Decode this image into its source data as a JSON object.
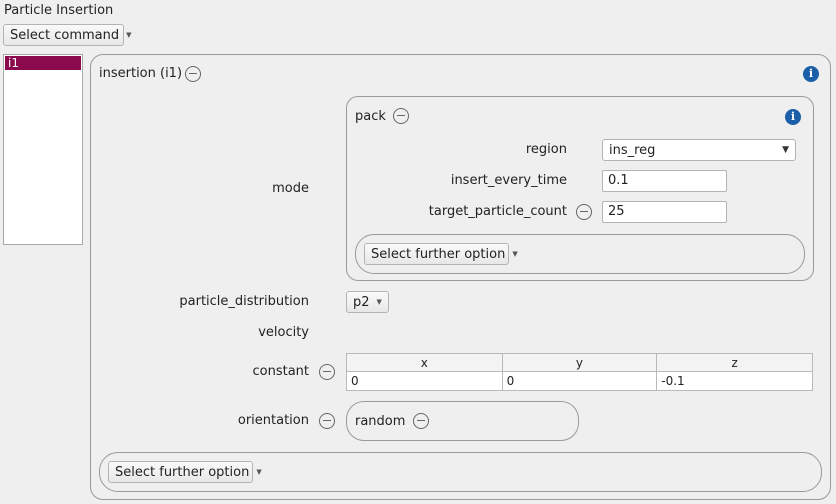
{
  "page": {
    "title": "Particle Insertion"
  },
  "toolbar": {
    "select_command": "Select command"
  },
  "instances": [
    "i1"
  ],
  "insertion": {
    "title": "insertion (i1)",
    "mode_label": "mode",
    "pack": {
      "title": "pack",
      "region_label": "region",
      "region_value": "ins_reg",
      "insert_every_time_label": "insert_every_time",
      "insert_every_time_value": "0.1",
      "target_particle_count_label": "target_particle_count",
      "target_particle_count_value": "25",
      "further_option": "Select further option"
    },
    "particle_distribution_label": "particle_distribution",
    "particle_distribution_value": "p2",
    "velocity_label": "velocity",
    "constant_label": "constant",
    "constant_headers": [
      "x",
      "y",
      "z"
    ],
    "constant_values": [
      "0",
      "0",
      "-0.1"
    ],
    "orientation_label": "orientation",
    "orientation_value": "random",
    "further_option": "Select further option"
  },
  "colors": {
    "selection": "#8b0a4e",
    "info": "#1a5fa8"
  }
}
